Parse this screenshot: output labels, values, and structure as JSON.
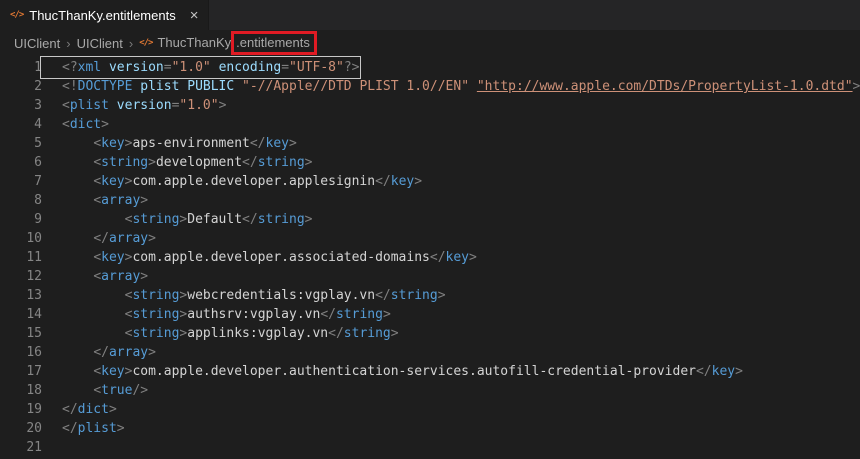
{
  "colors": {
    "editor-bg": "#1e1e1e",
    "tabbar-bg": "#252526",
    "tab-fg": "#ffffff",
    "breadcrumb-fg": "#a9a9a9",
    "linenum-fg": "#858585",
    "punct": "#808080",
    "tag": "#569cd6",
    "attr": "#9cdcfe",
    "string": "#ce9178",
    "text-fg": "#d4d4d4",
    "file-icon": "#e37933",
    "annotation": "#e01b24",
    "line-outline": "#c8c8c8"
  },
  "tab": {
    "title": "ThucThanKy.entitlements",
    "icon_glyph": "</>",
    "close_glyph": "×"
  },
  "breadcrumb": {
    "items": [
      "UIClient",
      "UIClient"
    ],
    "separator": "›",
    "file_icon_glyph": "</>",
    "file_base": "ThucThanKy",
    "file_ext": ".entitlements"
  },
  "editor": {
    "lines": [
      {
        "no": "1",
        "outlined": true,
        "tokens": [
          [
            "p",
            "<?"
          ],
          [
            "t",
            "xml"
          ],
          [
            "x",
            " "
          ],
          [
            "a",
            "version"
          ],
          [
            "p",
            "="
          ],
          [
            "s",
            "\"1.0\""
          ],
          [
            "x",
            " "
          ],
          [
            "a",
            "encoding"
          ],
          [
            "p",
            "="
          ],
          [
            "s",
            "\"UTF-8\""
          ],
          [
            "p",
            "?>"
          ]
        ]
      },
      {
        "no": "2",
        "tokens": [
          [
            "p",
            "<!"
          ],
          [
            "t",
            "DOCTYPE"
          ],
          [
            "x",
            " "
          ],
          [
            "a",
            "plist"
          ],
          [
            "x",
            " "
          ],
          [
            "a",
            "PUBLIC"
          ],
          [
            "x",
            " "
          ],
          [
            "s",
            "\"-//Apple//DTD PLIST 1.0//EN\""
          ],
          [
            "x",
            " "
          ],
          [
            "u",
            "\"http://www.apple.com/DTDs/PropertyList-1.0.dtd\""
          ],
          [
            "p",
            ">"
          ]
        ]
      },
      {
        "no": "3",
        "tokens": [
          [
            "p",
            "<"
          ],
          [
            "t",
            "plist"
          ],
          [
            "x",
            " "
          ],
          [
            "a",
            "version"
          ],
          [
            "p",
            "="
          ],
          [
            "s",
            "\"1.0\""
          ],
          [
            "p",
            ">"
          ]
        ]
      },
      {
        "no": "4",
        "tokens": [
          [
            "p",
            "<"
          ],
          [
            "t",
            "dict"
          ],
          [
            "p",
            ">"
          ]
        ]
      },
      {
        "no": "5",
        "tokens": [
          [
            "x",
            "    "
          ],
          [
            "p",
            "<"
          ],
          [
            "t",
            "key"
          ],
          [
            "p",
            ">"
          ],
          [
            "x",
            "aps-environment"
          ],
          [
            "p",
            "</"
          ],
          [
            "t",
            "key"
          ],
          [
            "p",
            ">"
          ]
        ]
      },
      {
        "no": "6",
        "tokens": [
          [
            "x",
            "    "
          ],
          [
            "p",
            "<"
          ],
          [
            "t",
            "string"
          ],
          [
            "p",
            ">"
          ],
          [
            "x",
            "development"
          ],
          [
            "p",
            "</"
          ],
          [
            "t",
            "string"
          ],
          [
            "p",
            ">"
          ]
        ]
      },
      {
        "no": "7",
        "tokens": [
          [
            "x",
            "    "
          ],
          [
            "p",
            "<"
          ],
          [
            "t",
            "key"
          ],
          [
            "p",
            ">"
          ],
          [
            "x",
            "com.apple.developer.applesignin"
          ],
          [
            "p",
            "</"
          ],
          [
            "t",
            "key"
          ],
          [
            "p",
            ">"
          ]
        ]
      },
      {
        "no": "8",
        "tokens": [
          [
            "x",
            "    "
          ],
          [
            "p",
            "<"
          ],
          [
            "t",
            "array"
          ],
          [
            "p",
            ">"
          ]
        ]
      },
      {
        "no": "9",
        "tokens": [
          [
            "x",
            "        "
          ],
          [
            "p",
            "<"
          ],
          [
            "t",
            "string"
          ],
          [
            "p",
            ">"
          ],
          [
            "x",
            "Default"
          ],
          [
            "p",
            "</"
          ],
          [
            "t",
            "string"
          ],
          [
            "p",
            ">"
          ]
        ]
      },
      {
        "no": "10",
        "tokens": [
          [
            "x",
            "    "
          ],
          [
            "p",
            "</"
          ],
          [
            "t",
            "array"
          ],
          [
            "p",
            ">"
          ]
        ]
      },
      {
        "no": "11",
        "tokens": [
          [
            "x",
            "    "
          ],
          [
            "p",
            "<"
          ],
          [
            "t",
            "key"
          ],
          [
            "p",
            ">"
          ],
          [
            "x",
            "com.apple.developer.associated-domains"
          ],
          [
            "p",
            "</"
          ],
          [
            "t",
            "key"
          ],
          [
            "p",
            ">"
          ]
        ]
      },
      {
        "no": "12",
        "tokens": [
          [
            "x",
            "    "
          ],
          [
            "p",
            "<"
          ],
          [
            "t",
            "array"
          ],
          [
            "p",
            ">"
          ]
        ]
      },
      {
        "no": "13",
        "tokens": [
          [
            "x",
            "        "
          ],
          [
            "p",
            "<"
          ],
          [
            "t",
            "string"
          ],
          [
            "p",
            ">"
          ],
          [
            "x",
            "webcredentials:vgplay.vn"
          ],
          [
            "p",
            "</"
          ],
          [
            "t",
            "string"
          ],
          [
            "p",
            ">"
          ]
        ]
      },
      {
        "no": "14",
        "tokens": [
          [
            "x",
            "        "
          ],
          [
            "p",
            "<"
          ],
          [
            "t",
            "string"
          ],
          [
            "p",
            ">"
          ],
          [
            "x",
            "authsrv:vgplay.vn"
          ],
          [
            "p",
            "</"
          ],
          [
            "t",
            "string"
          ],
          [
            "p",
            ">"
          ]
        ]
      },
      {
        "no": "15",
        "tokens": [
          [
            "x",
            "        "
          ],
          [
            "p",
            "<"
          ],
          [
            "t",
            "string"
          ],
          [
            "p",
            ">"
          ],
          [
            "x",
            "applinks:vgplay.vn"
          ],
          [
            "p",
            "</"
          ],
          [
            "t",
            "string"
          ],
          [
            "p",
            ">"
          ]
        ]
      },
      {
        "no": "16",
        "tokens": [
          [
            "x",
            "    "
          ],
          [
            "p",
            "</"
          ],
          [
            "t",
            "array"
          ],
          [
            "p",
            ">"
          ]
        ]
      },
      {
        "no": "17",
        "tokens": [
          [
            "x",
            "    "
          ],
          [
            "p",
            "<"
          ],
          [
            "t",
            "key"
          ],
          [
            "p",
            ">"
          ],
          [
            "x",
            "com.apple.developer.authentication-services.autofill-credential-provider"
          ],
          [
            "p",
            "</"
          ],
          [
            "t",
            "key"
          ],
          [
            "p",
            ">"
          ]
        ]
      },
      {
        "no": "18",
        "tokens": [
          [
            "x",
            "    "
          ],
          [
            "p",
            "<"
          ],
          [
            "t",
            "true"
          ],
          [
            "p",
            "/>"
          ]
        ]
      },
      {
        "no": "19",
        "tokens": [
          [
            "p",
            "</"
          ],
          [
            "t",
            "dict"
          ],
          [
            "p",
            ">"
          ]
        ]
      },
      {
        "no": "20",
        "tokens": [
          [
            "p",
            "</"
          ],
          [
            "t",
            "plist"
          ],
          [
            "p",
            ">"
          ]
        ]
      },
      {
        "no": "21",
        "tokens": []
      }
    ]
  }
}
